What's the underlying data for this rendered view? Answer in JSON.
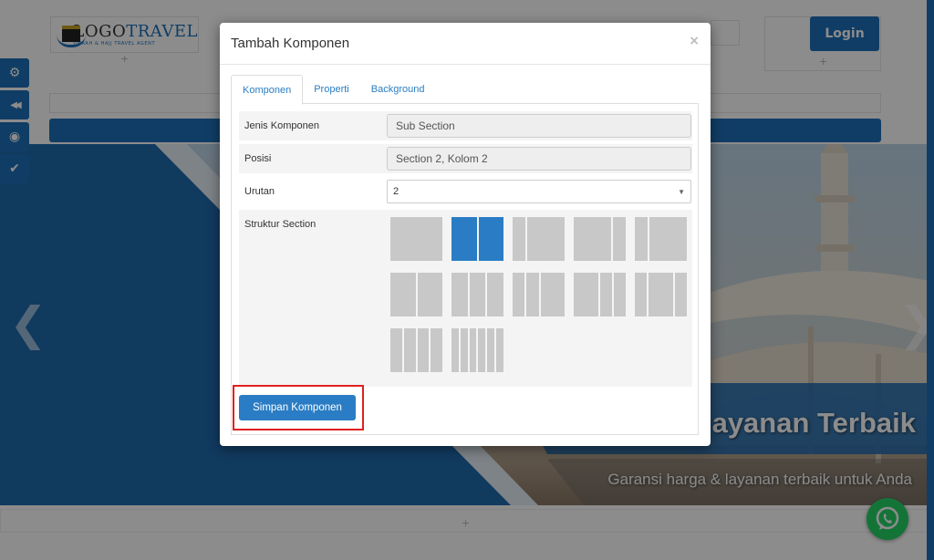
{
  "background": {
    "logo": {
      "brand_a": "LOGO",
      "brand_b": "TRAVEL",
      "tagline": "UMRAH & HAJJ TRAVEL AGENT"
    },
    "login_label": "Login",
    "plus": "+",
    "side_tools": [
      {
        "icon": "gears-icon",
        "glyph": "⚙"
      },
      {
        "icon": "rewind-icon",
        "glyph": "◀◀"
      },
      {
        "icon": "eye-icon",
        "glyph": "◉"
      },
      {
        "icon": "check-icon",
        "glyph": "✔"
      }
    ],
    "hero": {
      "prev": "❮",
      "next": "❯",
      "title": "ayanan Terbaik",
      "subtitle": "Garansi harga & layanan terbaik untuk Anda"
    }
  },
  "modal": {
    "title": "Tambah Komponen",
    "close": "×",
    "tabs": [
      {
        "label": "Komponen",
        "active": true
      },
      {
        "label": "Properti",
        "active": false
      },
      {
        "label": "Background",
        "active": false
      }
    ],
    "fields": {
      "jenis": {
        "label": "Jenis Komponen",
        "value": "Sub Section"
      },
      "posisi": {
        "label": "Posisi",
        "value": "Section 2, Kolom 2"
      },
      "urutan": {
        "label": "Urutan",
        "value": "2",
        "arrow": "▼"
      },
      "struktur": {
        "label": "Struktur Section"
      }
    },
    "layouts": [
      {
        "cols": [
          1
        ],
        "selected": false
      },
      {
        "cols": [
          1,
          1
        ],
        "selected": true
      },
      {
        "cols": [
          1,
          3
        ],
        "selected": false
      },
      {
        "cols": [
          3,
          1
        ],
        "selected": false
      },
      {
        "cols": [
          1,
          3
        ],
        "selected": false
      },
      {
        "cols": [
          1,
          1
        ],
        "selected": false
      },
      {
        "cols": [
          1,
          1,
          1
        ],
        "selected": false
      },
      {
        "cols": [
          1,
          1,
          2
        ],
        "selected": false
      },
      {
        "cols": [
          2,
          1,
          1
        ],
        "selected": false
      },
      {
        "cols": [
          1,
          2,
          1
        ],
        "selected": false
      },
      {
        "cols": [
          1,
          1,
          1,
          1
        ],
        "selected": false
      },
      {
        "cols": [
          1,
          1,
          1,
          1,
          1,
          1
        ],
        "selected": false
      }
    ],
    "save_label": "Simpan Komponen"
  },
  "colors": {
    "primary": "#2a7dc4",
    "brand_blue": "#1e6fb8",
    "highlight": "#e02020",
    "whatsapp": "#25d366"
  }
}
